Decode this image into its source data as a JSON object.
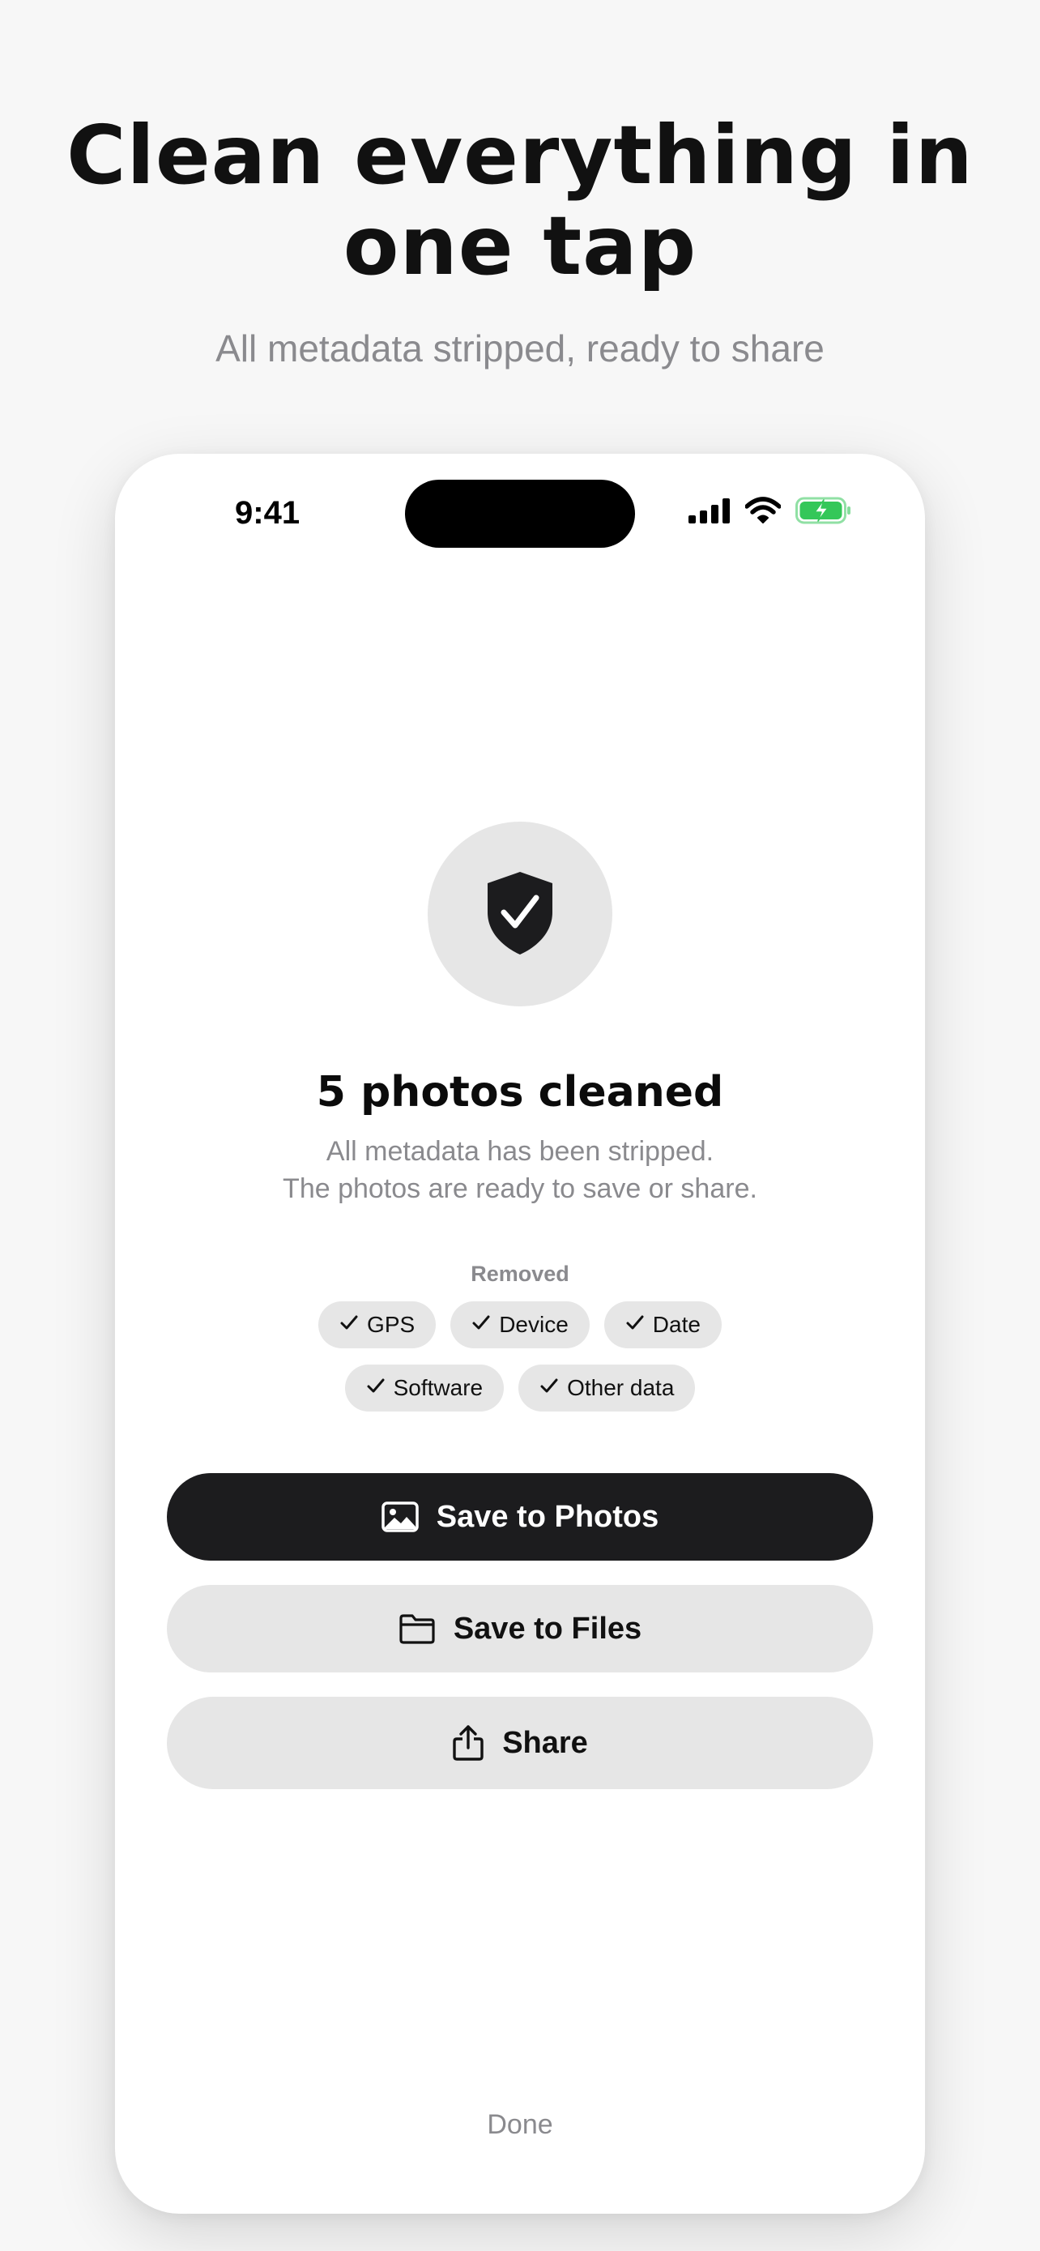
{
  "marketing": {
    "headline_line1": "Clean everything in",
    "headline_line2": "one tap",
    "subheadline": "All metadata stripped, ready to share"
  },
  "status_bar": {
    "time": "9:41",
    "icons": [
      "cellular-signal-icon",
      "wifi-icon",
      "battery-charging-icon"
    ]
  },
  "result": {
    "icon": "shield-check-icon",
    "title": "5 photos cleaned",
    "description_line1": "All metadata has been stripped.",
    "description_line2": "The photos are ready to save or share."
  },
  "removed": {
    "label": "Removed",
    "chips": [
      {
        "label": "GPS",
        "icon": "check-icon"
      },
      {
        "label": "Device",
        "icon": "check-icon"
      },
      {
        "label": "Date",
        "icon": "check-icon"
      },
      {
        "label": "Software",
        "icon": "check-icon"
      },
      {
        "label": "Other data",
        "icon": "check-icon"
      }
    ]
  },
  "actions": {
    "save_to_photos": {
      "label": "Save to Photos",
      "icon": "photo-icon"
    },
    "save_to_files": {
      "label": "Save to Files",
      "icon": "folder-icon"
    },
    "share": {
      "label": "Share",
      "icon": "share-icon"
    }
  },
  "done": {
    "label": "Done"
  },
  "colors": {
    "background": "#f7f7f7",
    "card": "#ffffff",
    "primary_button": "#1c1c1e",
    "secondary_button": "#e6e6e6",
    "muted_text": "#8a8a8e",
    "battery_green": "#34c759"
  }
}
